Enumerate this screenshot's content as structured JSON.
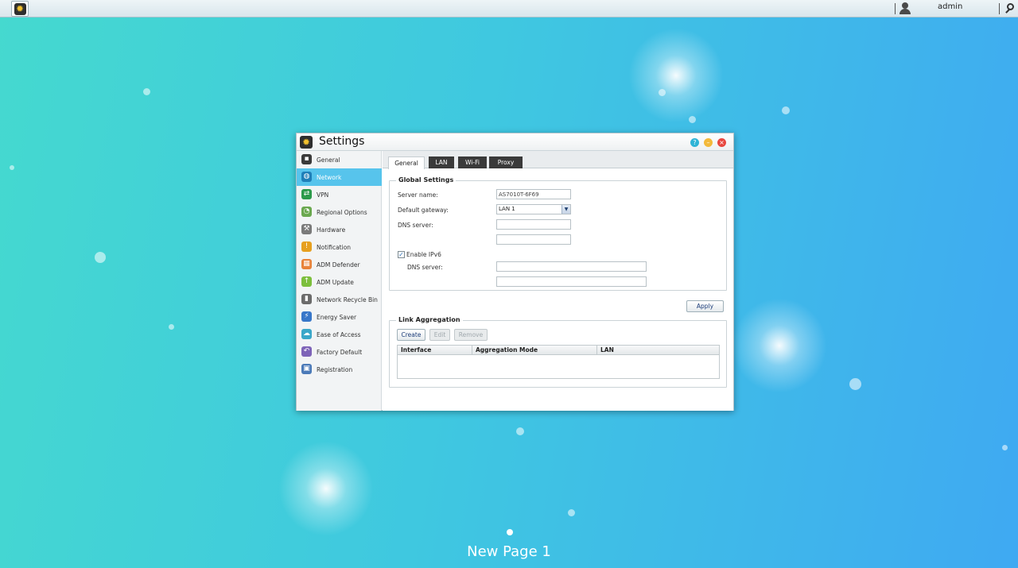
{
  "topbar": {
    "username": "admin"
  },
  "window": {
    "title": "Settings"
  },
  "sidebar": {
    "items": [
      {
        "label": "General",
        "icon": "monitor-icon",
        "color": "#3a3a3a"
      },
      {
        "label": "Network",
        "icon": "globe-icon",
        "color": "#1f7fb8",
        "active": true
      },
      {
        "label": "VPN",
        "icon": "vpn-icon",
        "color": "#2c9a4b"
      },
      {
        "label": "Regional Options",
        "icon": "clock-globe-icon",
        "color": "#6aa84f"
      },
      {
        "label": "Hardware",
        "icon": "wrench-icon",
        "color": "#7a7a7a"
      },
      {
        "label": "Notification",
        "icon": "alert-icon",
        "color": "#e6a020"
      },
      {
        "label": "ADM Defender",
        "icon": "firewall-icon",
        "color": "#e8833a"
      },
      {
        "label": "ADM Update",
        "icon": "update-arrow-icon",
        "color": "#7cbf3c"
      },
      {
        "label": "Network Recycle Bin",
        "icon": "trash-icon",
        "color": "#6b6b6b"
      },
      {
        "label": "Energy Saver",
        "icon": "lightning-icon",
        "color": "#3877c9"
      },
      {
        "label": "Ease of Access",
        "icon": "cloud-upload-icon",
        "color": "#3aa7c9"
      },
      {
        "label": "Factory Default",
        "icon": "undo-icon",
        "color": "#7e64b8"
      },
      {
        "label": "Registration",
        "icon": "registration-icon",
        "color": "#4b7ab8"
      }
    ]
  },
  "tabs": [
    {
      "label": "General",
      "active": true
    },
    {
      "label": "LAN"
    },
    {
      "label": "Wi-Fi"
    },
    {
      "label": "Proxy"
    }
  ],
  "global_settings": {
    "legend": "Global Settings",
    "server_name_label": "Server name:",
    "server_name_value": "AS7010T-6F69",
    "gateway_label": "Default gateway:",
    "gateway_value": "LAN 1",
    "dns_label": "DNS server:",
    "dns1_value": "",
    "dns2_value": "",
    "ipv6_label": "Enable IPv6",
    "ipv6_checked": true,
    "ipv6_dns_label": "DNS server:",
    "ipv6_dns1_value": "",
    "ipv6_dns2_value": ""
  },
  "apply_label": "Apply",
  "link_aggregation": {
    "legend": "Link Aggregation",
    "create_label": "Create",
    "edit_label": "Edit",
    "remove_label": "Remove",
    "columns": [
      "Interface",
      "Aggregation Mode",
      "LAN"
    ],
    "rows": []
  },
  "desktop": {
    "page_label": "New Page 1"
  }
}
